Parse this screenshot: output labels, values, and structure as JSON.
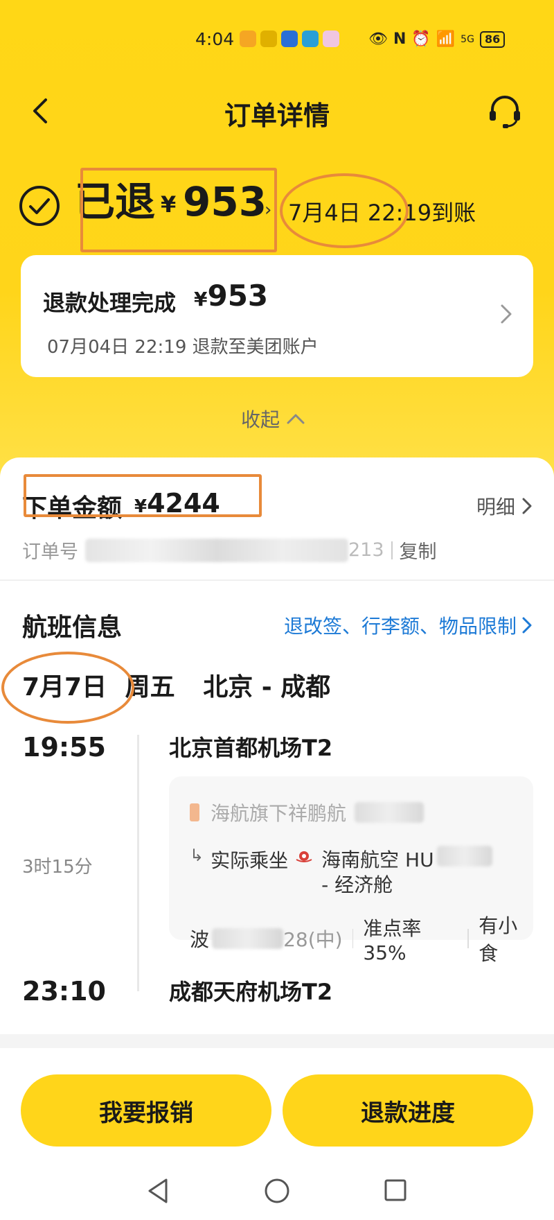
{
  "status_bar": {
    "time": "4:04",
    "battery": "86",
    "signal": "5G"
  },
  "nav": {
    "title": "订单详情"
  },
  "refund": {
    "status": "已退",
    "currency": "¥",
    "amount": "953",
    "arrival_text": "7月4日 22:19到账"
  },
  "refund_card": {
    "title": "退款处理完成",
    "currency": "¥",
    "amount": "953",
    "subtitle": "07月04日 22:19 退款至美团账户"
  },
  "collapse_label": "收起",
  "order": {
    "label": "下单金额",
    "currency": "¥",
    "amount": "4244",
    "detail_label": "明细",
    "order_no_label": "订单号",
    "order_no_tail": "213",
    "copy_label": "复制"
  },
  "flight": {
    "section_title": "航班信息",
    "rules_link": "退改签、行李额、物品限制",
    "date": "7月7日",
    "weekday": "周五",
    "route": "北京 - 成都",
    "departure_time": "19:55",
    "departure_airport": "北京首都机场T2",
    "duration": "3时15分",
    "arrival_time": "23:10",
    "arrival_airport": "成都天府机场T2",
    "marketing_airline": "海航旗下祥鹏航",
    "actual_label": "实际乘坐",
    "operating_airline": "海南航空 HU",
    "cabin": "- 经济舱",
    "aircraft_prefix": "波",
    "aircraft_suffix": "28(中)",
    "on_time_rate": "准点率35%",
    "meal": "有小食"
  },
  "buttons": {
    "reimburse": "我要报销",
    "refund_progress": "退款进度"
  },
  "colors": {
    "brand_yellow": "#ffd51a",
    "link_blue": "#1d7ad6",
    "annotation_orange": "#e88a3a"
  }
}
